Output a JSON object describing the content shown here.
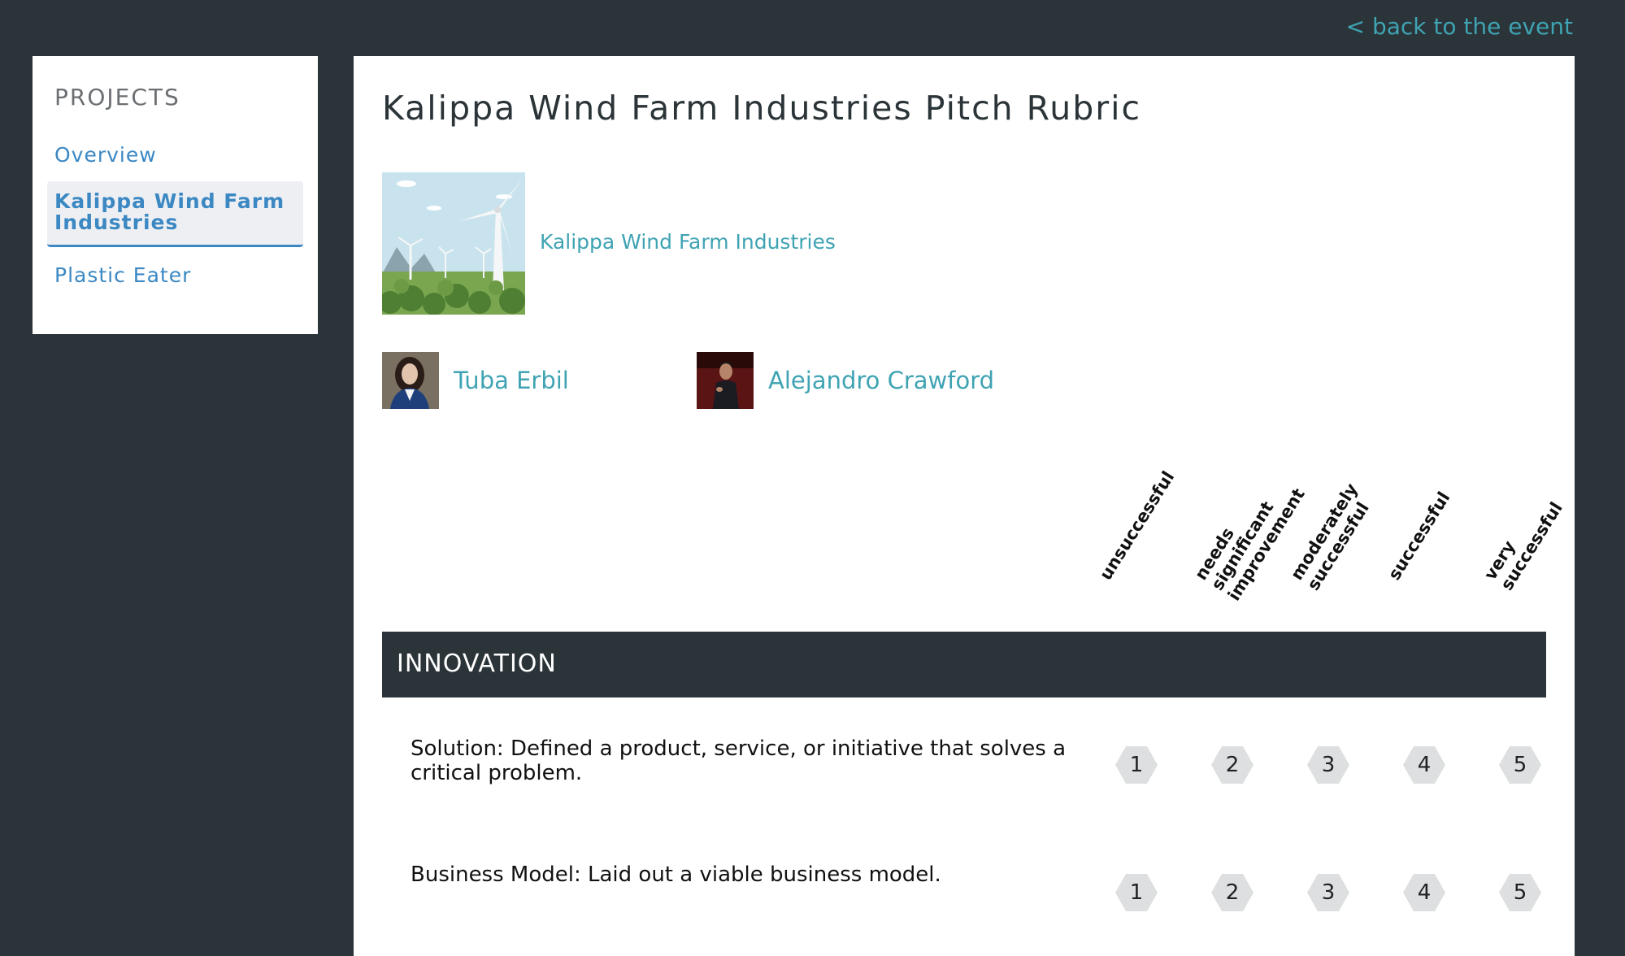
{
  "header": {
    "back_link": "< back to the event"
  },
  "sidebar": {
    "heading": "PROJECTS",
    "items": [
      {
        "label": "Overview",
        "active": false
      },
      {
        "label": "Kalippa Wind Farm Industries",
        "active": true
      },
      {
        "label": "Plastic Eater",
        "active": false
      }
    ]
  },
  "main": {
    "title": "Kalippa Wind Farm Industries Pitch Rubric",
    "project": {
      "name": "Kalippa Wind Farm Industries",
      "thumbnail": "wind-farm-illustration"
    },
    "members": [
      {
        "name": "Tuba Erbil"
      },
      {
        "name": "Alejandro Crawford"
      }
    ],
    "scale_labels": [
      "unsuccessful",
      "needs significant improvement",
      "moderately successful",
      "successful",
      "very successful"
    ],
    "sections": [
      {
        "title": "INNOVATION",
        "criteria": [
          {
            "text": "Solution: Defined a product, service, or initiative that solves a critical problem.",
            "scores": [
              "1",
              "2",
              "3",
              "4",
              "5"
            ]
          },
          {
            "text": "Business Model: Laid out a viable business model.",
            "scores": [
              "1",
              "2",
              "3",
              "4",
              "5"
            ]
          }
        ]
      }
    ]
  },
  "colors": {
    "background": "#2b3438",
    "link": "#3fa3b3",
    "nav": "#3b88c3",
    "score_bg": "#dddfe0"
  }
}
